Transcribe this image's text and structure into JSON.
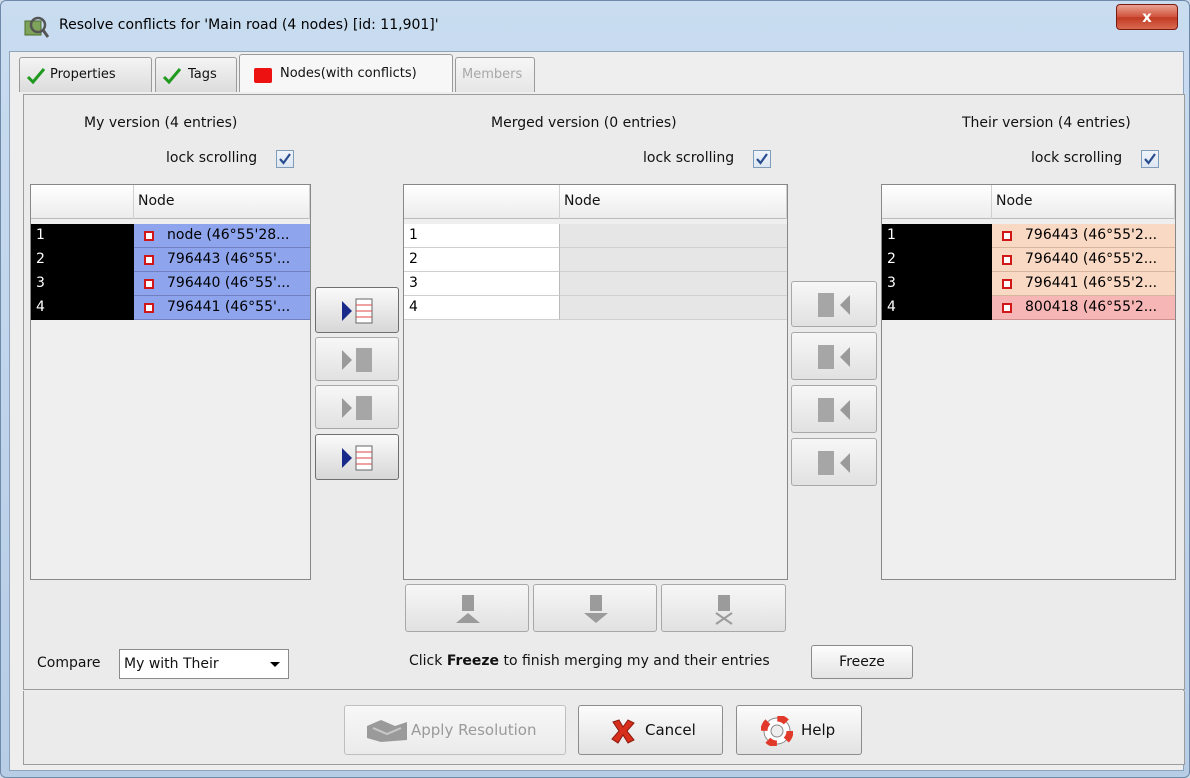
{
  "window": {
    "title": "Resolve conflicts for 'Main road (4 nodes) [id: 11,901]'",
    "close_label": "x"
  },
  "tabs": [
    {
      "label": "Properties",
      "icon": "checkmark-icon"
    },
    {
      "label": "Tags",
      "icon": "checkmark-icon"
    },
    {
      "label": "Nodes(with conflicts)",
      "icon": "red-square-icon",
      "active": true
    },
    {
      "label": "Members",
      "disabled": true
    }
  ],
  "my_version": {
    "caption": "My version (4 entries)",
    "lock_label": "lock scrolling",
    "lock_checked": true,
    "column_header": "Node",
    "rows": [
      {
        "num": "1",
        "value": "node (46°55'28..."
      },
      {
        "num": "2",
        "value": "796443 (46°55'..."
      },
      {
        "num": "3",
        "value": "796440 (46°55'..."
      },
      {
        "num": "4",
        "value": "796441 (46°55'..."
      }
    ]
  },
  "merged_version": {
    "caption": "Merged version (0 entries)",
    "lock_label": "lock scrolling",
    "lock_checked": true,
    "column_header": "Node",
    "rows": [
      {
        "num": "1",
        "value": ""
      },
      {
        "num": "2",
        "value": ""
      },
      {
        "num": "3",
        "value": ""
      },
      {
        "num": "4",
        "value": ""
      }
    ]
  },
  "their_version": {
    "caption": "Their version (4 entries)",
    "lock_label": "lock scrolling",
    "lock_checked": true,
    "column_header": "Node",
    "rows": [
      {
        "num": "1",
        "value": "796443 (46°55'2...",
        "state": "theirs"
      },
      {
        "num": "2",
        "value": "796440 (46°55'2...",
        "state": "theirs"
      },
      {
        "num": "3",
        "value": "796441 (46°55'2...",
        "state": "theirs"
      },
      {
        "num": "4",
        "value": "800418 (46°55'2...",
        "state": "conflict"
      }
    ]
  },
  "compare": {
    "label": "Compare",
    "selected": "My with Their"
  },
  "freeze": {
    "instruction_prefix": "Click ",
    "instruction_bold": "Freeze",
    "instruction_suffix": " to finish merging my and their entries",
    "button_label": "Freeze"
  },
  "buttons": {
    "apply": "Apply Resolution",
    "cancel": "Cancel",
    "help": "Help"
  },
  "colors": {
    "my_row": "#8ea5ee",
    "their_row": "#f9d9c3",
    "conflict_row": "#f7b6b6",
    "selected_num": "#000000",
    "accent_arrow": "#1a2a8a"
  }
}
